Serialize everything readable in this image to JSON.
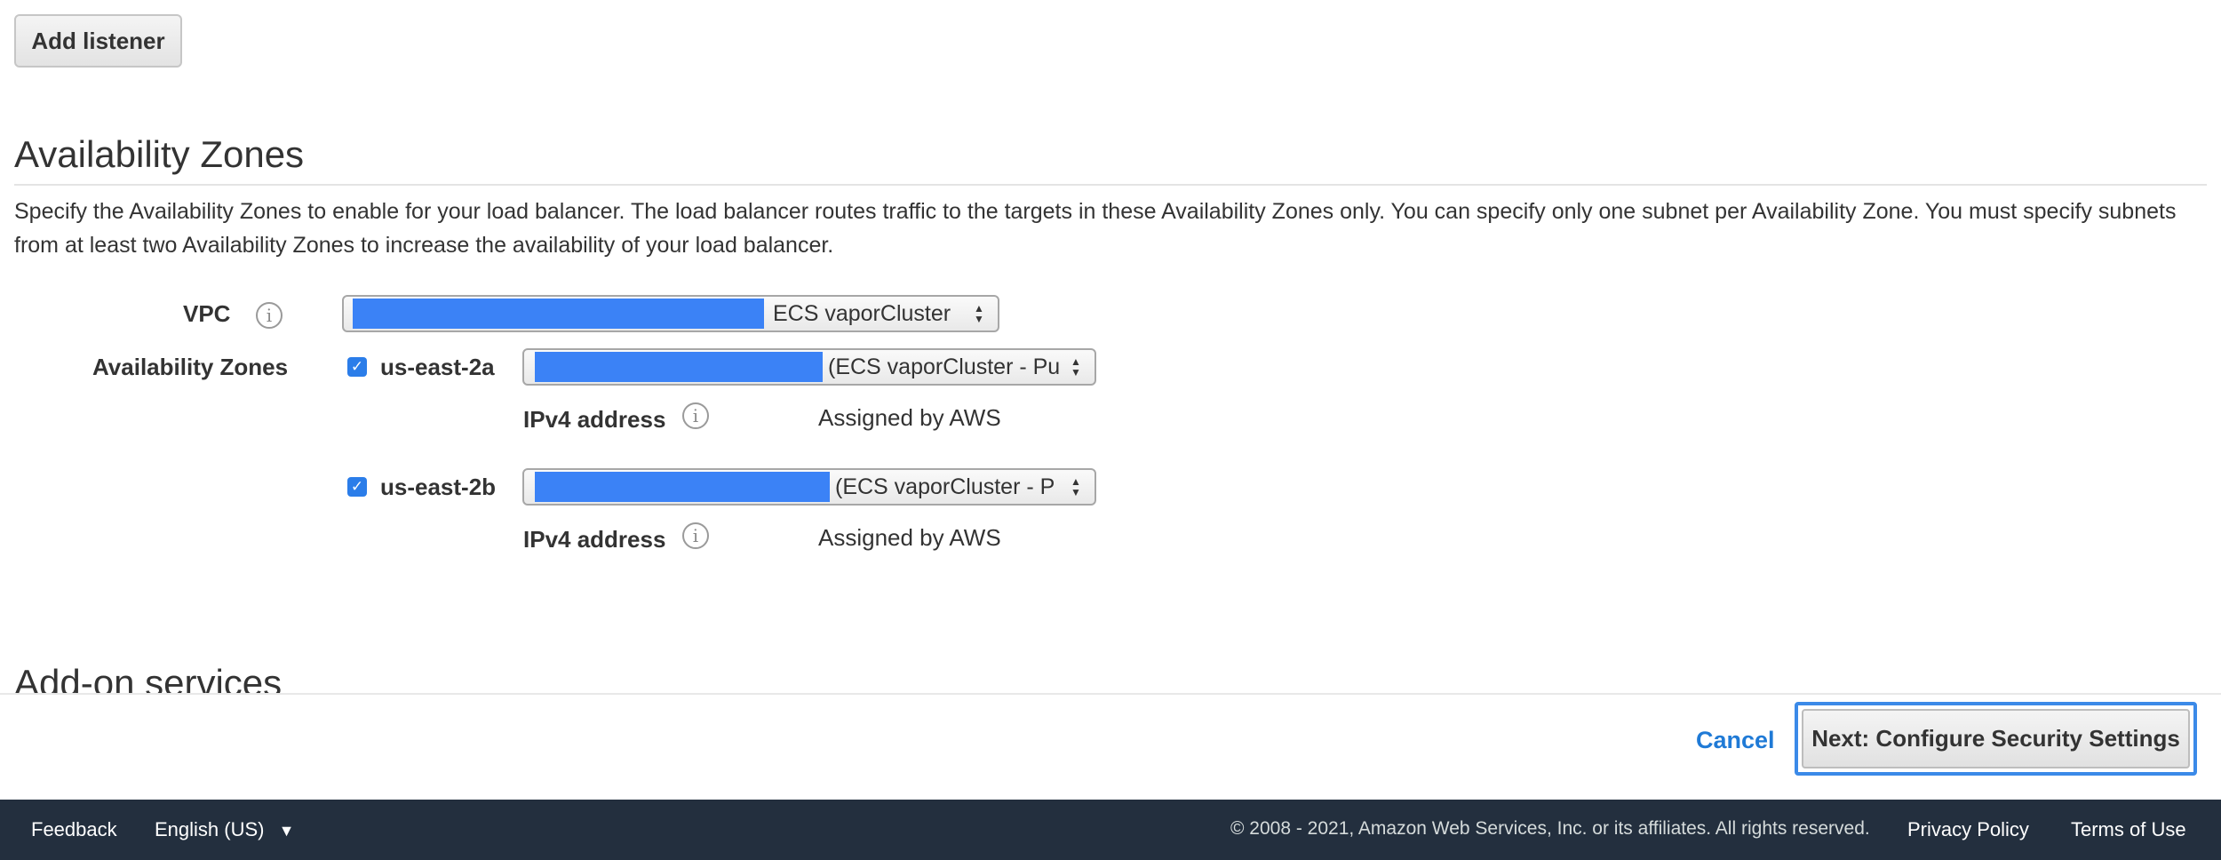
{
  "listeners": {
    "add_button": "Add listener"
  },
  "availability": {
    "heading": "Availability Zones",
    "description": "Specify the Availability Zones to enable for your load balancer. The load balancer routes traffic to the targets in these Availability Zones only. You can specify only one subnet per Availability Zone. You must specify subnets from at least two Availability Zones to increase the availability of your load balancer.",
    "vpc": {
      "label": "VPC",
      "info_icon": "info-icon",
      "selected": "ECS vaporCluster"
    },
    "zones_label": "Availability Zones",
    "zones": [
      {
        "name": "us-east-2a",
        "checked": true,
        "subnet": "(ECS vaporCluster - Pu",
        "ipv4_label": "IPv4 address",
        "ipv4_value": "Assigned by AWS"
      },
      {
        "name": "us-east-2b",
        "checked": true,
        "subnet": "(ECS vaporCluster - P",
        "ipv4_label": "IPv4 address",
        "ipv4_value": "Assigned by AWS"
      }
    ]
  },
  "addon": {
    "heading": "Add-on services"
  },
  "actions": {
    "cancel": "Cancel",
    "next": "Next: Configure Security Settings"
  },
  "footer": {
    "feedback": "Feedback",
    "language": "English (US)",
    "copyright": "© 2008 - 2021, Amazon Web Services, Inc. or its affiliates. All rights reserved.",
    "privacy": "Privacy Policy",
    "terms": "Terms of Use"
  },
  "colors": {
    "accent": "#1f7ad6",
    "redaction": "#3b82f6",
    "footer_bg": "#232f3e",
    "focus_ring": "#3b8ae8"
  }
}
